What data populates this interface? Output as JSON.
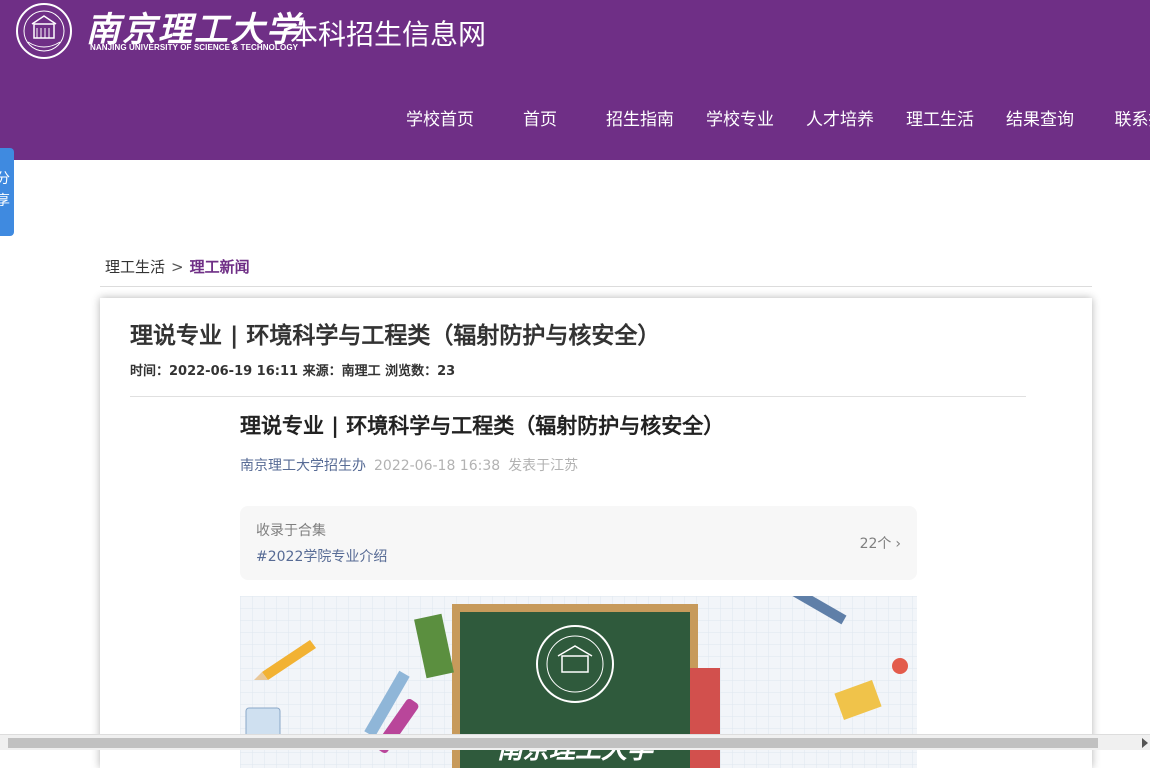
{
  "header": {
    "logo_cn": "南京理工大学",
    "logo_en": "NANJING UNIVERSITY OF SCIENCE & TECHNOLOGY",
    "site_title": "本科招生信息网",
    "nav": [
      "学校首页",
      "首页",
      "招生指南",
      "学校专业",
      "人才培养",
      "理工生活",
      "结果查询",
      "联系招"
    ]
  },
  "share": {
    "label_1": "分",
    "label_2": "享"
  },
  "breadcrumb": {
    "parent": "理工生活",
    "separator": ">",
    "current": "理工新闻"
  },
  "article": {
    "title": "理说专业 | 环境科学与工程类（辐射防护与核安全）",
    "meta": "时间：2022-06-19 16:11 来源：南理工 浏览数：23",
    "inner_title": "理说专业 | 环境科学与工程类（辐射防护与核安全）",
    "inner_author": "南京理工大学招生办",
    "inner_date": "2022-06-18 16:38",
    "inner_location": "发表于江苏",
    "collection": {
      "label": "收录于合集",
      "tag": "#2022学院专业介绍",
      "count": "22个"
    },
    "banner_text": "南京理工大学"
  },
  "colors": {
    "brand_purple": "#6f2f86",
    "link_blue": "#576b95",
    "share_blue": "#3f8ae0",
    "board_green": "#2f5a3c"
  }
}
